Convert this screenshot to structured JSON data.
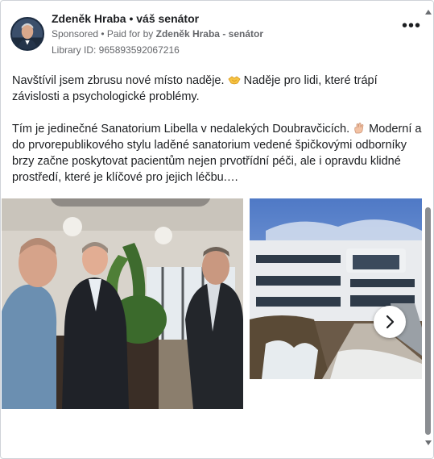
{
  "ad": {
    "page_name": "Zdeněk Hraba • váš senátor",
    "sponsored": "Sponsored",
    "paid_for_prefix": " • Paid for by ",
    "payer": "Zdeněk Hraba - senátor",
    "library_id": "Library ID: 965893592067216",
    "more_options": "•••"
  },
  "post": {
    "paragraph1_a": "Navštívil jsem zbrusu nové místo naděje. ",
    "paragraph1_b": " Naděje pro lidi, které trápí závislosti a psychologické problémy.",
    "paragraph2_a": "Tím je jedinečné Sanatorium Libella v nedalekých Doubravčicích. ",
    "paragraph2_b": " Moderní a do prvorepublikového stylu laděné sanatorium vedené špičkovými odborníky brzy začne poskytovat pacientům nejen prvotřídní péči, ale i opravdu klidné prostředí, které je klíčové pro jejich léčbu.…"
  },
  "icons": {
    "emoji1": "handshake-emoji-icon",
    "emoji2": "hand-emoji-icon",
    "next": "chevron-right-icon",
    "more": "more-options-icon"
  },
  "colors": {
    "text": "#1c1e21",
    "secondary": "#65676b",
    "scrollbar_thumb": "#8a8d91"
  }
}
